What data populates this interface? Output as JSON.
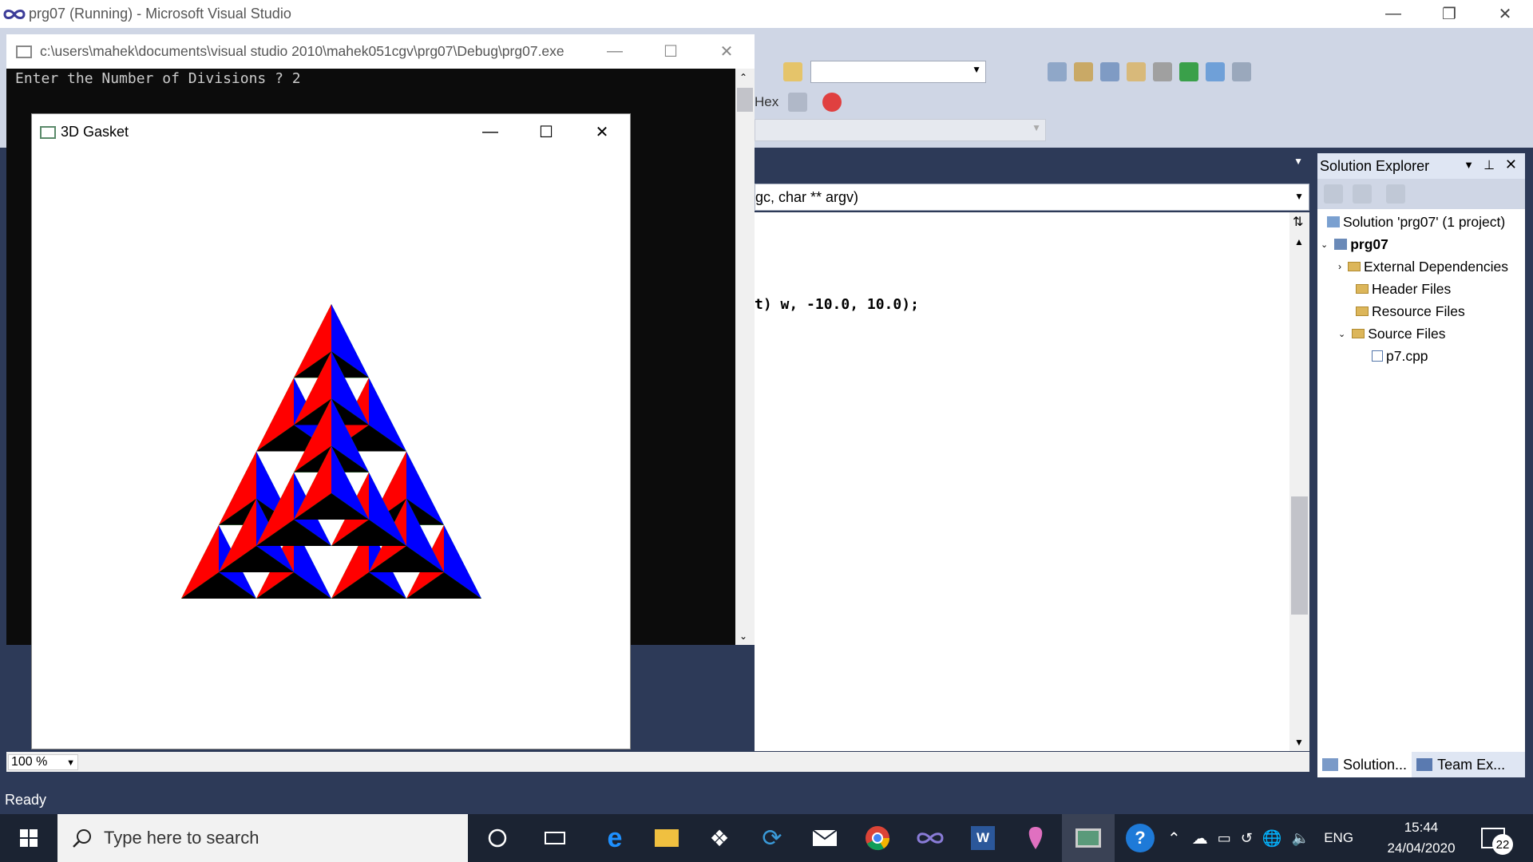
{
  "vs": {
    "title": "prg07 (Running) - Microsoft Visual Studio",
    "nav_dropdown_text": "gc, char ** argv)",
    "toolbar_hex_label": "Hex",
    "code_line": "t) w, -10.0, 10.0);",
    "zoom": "100 %",
    "status": "Ready"
  },
  "solution_explorer": {
    "title": "Solution Explorer",
    "items": [
      {
        "label": "Solution 'prg07' (1 project)"
      },
      {
        "label": "prg07"
      },
      {
        "label": "External Dependencies"
      },
      {
        "label": "Header Files"
      },
      {
        "label": "Resource Files"
      },
      {
        "label": "Source Files"
      },
      {
        "label": "p7.cpp"
      }
    ],
    "tabs": [
      "Solution...",
      "Team Ex..."
    ]
  },
  "console": {
    "title": "c:\\users\\mahek\\documents\\visual studio 2010\\mahek051cgv\\prg07\\Debug\\prg07.exe",
    "text": "Enter the Number of Divisions ? 2"
  },
  "gasket": {
    "title": "3D Gasket",
    "colors": {
      "red": "#ff0000",
      "green": "#00ff00",
      "blue": "#0000ff",
      "black": "#000000",
      "white": "#ffffff"
    }
  },
  "taskbar": {
    "search_placeholder": "Type here to search",
    "language": "ENG",
    "time": "15:44",
    "date": "24/04/2020",
    "notifications": "22"
  }
}
